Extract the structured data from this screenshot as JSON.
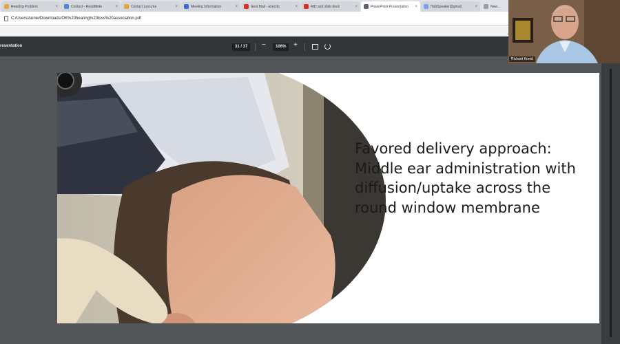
{
  "browser": {
    "tabs": [
      {
        "label": "Reading Problem",
        "color": "#e8a33d",
        "active": false
      },
      {
        "label": "Contact - ReadWrite",
        "color": "#4f86d9",
        "active": false
      },
      {
        "label": "Contact Lexcyne",
        "color": "#e8a33d",
        "active": false
      },
      {
        "label": "Meeting Information",
        "color": "#3a6fd8",
        "active": false
      },
      {
        "label": "Sent Mail - anecdo",
        "color": "#d93025",
        "active": false
      },
      {
        "label": "RID and slide deck",
        "color": "#d93025",
        "active": false
      },
      {
        "label": "PowerPoint Presentation",
        "color": "#5f6368",
        "active": true
      },
      {
        "label": "HubSpeaker@gmail",
        "color": "#7ba1e8",
        "active": false
      },
      {
        "label": "New Tab",
        "color": "#9aa0a6",
        "active": false
      }
    ],
    "url": "C:/Users/Annie/Downloads/OK%20hearing%20loss%20association.pdf"
  },
  "pdf_toolbar": {
    "title": "resentation",
    "page_current": "31",
    "page_total": "37",
    "page_text": "31 / 37",
    "zoom_out_label": "−",
    "zoom_level": "106%",
    "zoom_in_label": "+"
  },
  "slide": {
    "lines": [
      "Favored delivery approach:",
      "Middle ear administration with",
      "diffusion/uptake across the",
      "round window membrane"
    ]
  },
  "webcam": {
    "participant_name": "Richard Kreed"
  },
  "colors": {
    "tab_strip": "#dee1e6",
    "pdf_toolbar": "#323639",
    "viewer_background": "#525659"
  }
}
